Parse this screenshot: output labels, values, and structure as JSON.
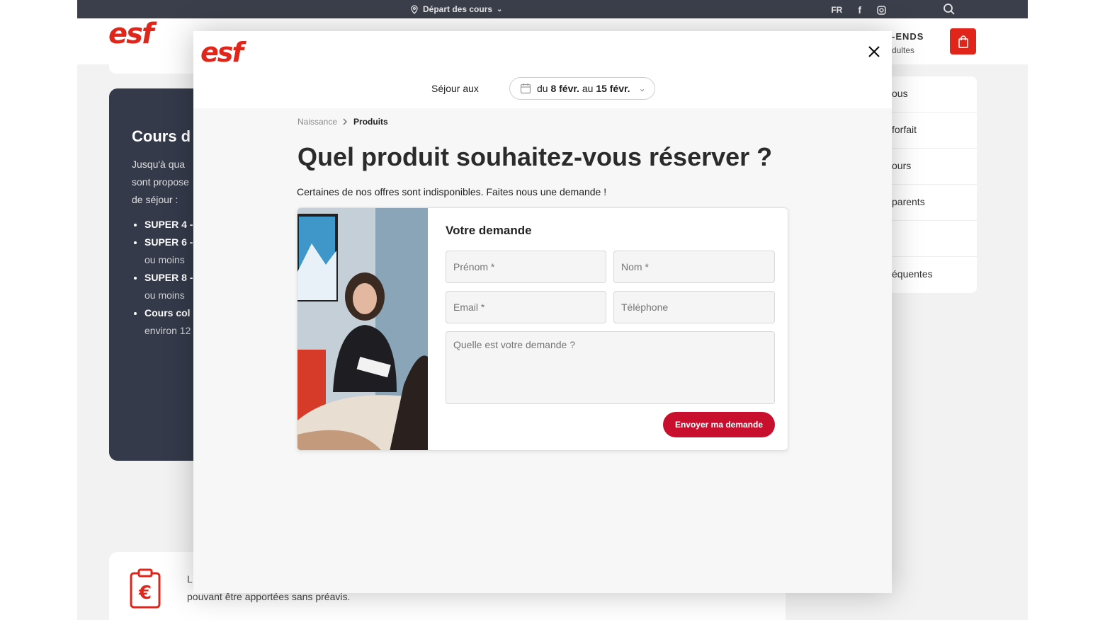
{
  "topbar": {
    "location_label": "Départ des cours",
    "language": "FR"
  },
  "header": {
    "logo_text": "esf",
    "menu_partial": "-ENDS",
    "menu_partial_sub": "dultes"
  },
  "background": {
    "card_title": "Cours d",
    "card_intro": "Jusqu'à  qua\nsont propose\nde séjour :",
    "card_items": [
      {
        "bold": "SUPER 4 -",
        "rest": ""
      },
      {
        "bold": "SUPER 6 -",
        "rest": "ou moins"
      },
      {
        "bold": "SUPER 8 -",
        "rest": "ou moins"
      },
      {
        "bold": "Cours col",
        "rest": "environ 12"
      }
    ],
    "side_menu": [
      "ous",
      "forfait",
      "ours",
      "parents",
      "",
      "équentes"
    ],
    "bottom_text_l": "L",
    "bottom_text": "pouvant être apportées sans préavis."
  },
  "modal": {
    "logo_text": "esf",
    "sejour_label": "Séjour aux",
    "date": {
      "prefix": "du",
      "start": "8 févr.",
      "mid": "au",
      "end": "15 févr."
    },
    "breadcrumb": {
      "parent": "Naissance",
      "current": "Produits"
    },
    "title": "Quel produit souhaitez-vous réserver ?",
    "subtitle": "Certaines de nos offres sont indisponibles. Faites nous une demande !",
    "form": {
      "title": "Votre demande",
      "prenom_placeholder": "Prénom *",
      "nom_placeholder": "Nom *",
      "email_placeholder": "Email *",
      "tel_placeholder": "Téléphone",
      "message_placeholder": "Quelle est votre demande ?",
      "submit_label": "Envoyer ma demande"
    }
  },
  "colors": {
    "brand": "#e1251b",
    "button": "#c8102e",
    "topbar": "#3a3f4b",
    "dark_card": "#343a4a"
  }
}
